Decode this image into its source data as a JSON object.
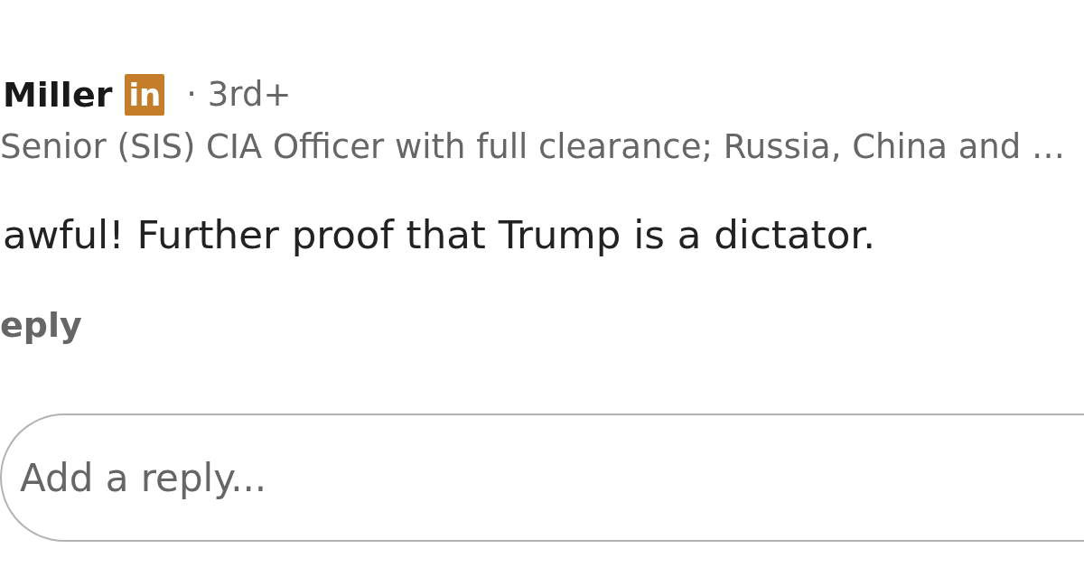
{
  "comment": {
    "author": {
      "name": "Miller",
      "badge": "in",
      "degree": "· 3rd+",
      "headline": "Senior (SIS) CIA Officer with full clearance; Russia, China and …"
    },
    "text": "awful! Further proof that Trump is a dictator.",
    "actions": [
      "eply"
    ]
  },
  "reply_field": {
    "placeholder": "Add a reply..."
  }
}
